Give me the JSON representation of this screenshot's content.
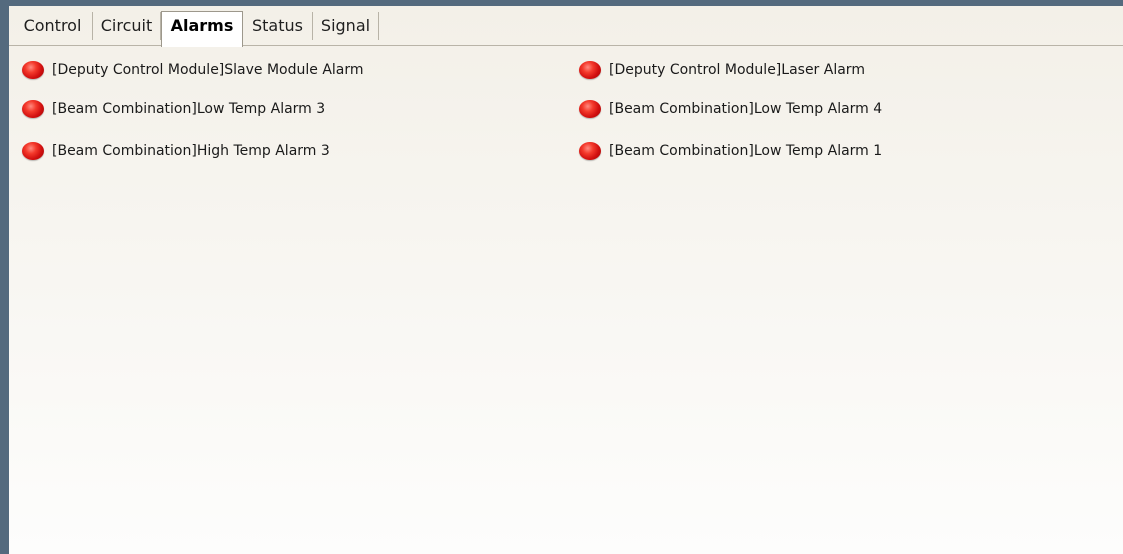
{
  "tabs": [
    {
      "label": "Control"
    },
    {
      "label": "Circuit"
    },
    {
      "label": "Alarms",
      "active": true
    },
    {
      "label": "Status"
    },
    {
      "label": "Signal"
    }
  ],
  "alarms": [
    {
      "label": "[Deputy Control Module]Slave Module Alarm",
      "state": "active",
      "icon": "red-led-icon"
    },
    {
      "label": "[Deputy Control Module]Laser Alarm",
      "state": "active",
      "icon": "red-led-icon"
    },
    {
      "label": "[Beam Combination]Low Temp Alarm 3",
      "state": "active",
      "icon": "red-led-icon"
    },
    {
      "label": "[Beam Combination]Low Temp Alarm 4",
      "state": "active",
      "icon": "red-led-icon"
    },
    {
      "label": "[Beam Combination]High Temp Alarm 3",
      "state": "active",
      "icon": "red-led-icon"
    },
    {
      "label": "[Beam Combination]Low Temp Alarm 1",
      "state": "active",
      "icon": "red-led-icon"
    }
  ],
  "colors": {
    "frame": "#546a7e",
    "alarm_led": "#e0201a",
    "panel_top": "#f3f0e8",
    "panel_bottom": "#fdfdfc"
  }
}
